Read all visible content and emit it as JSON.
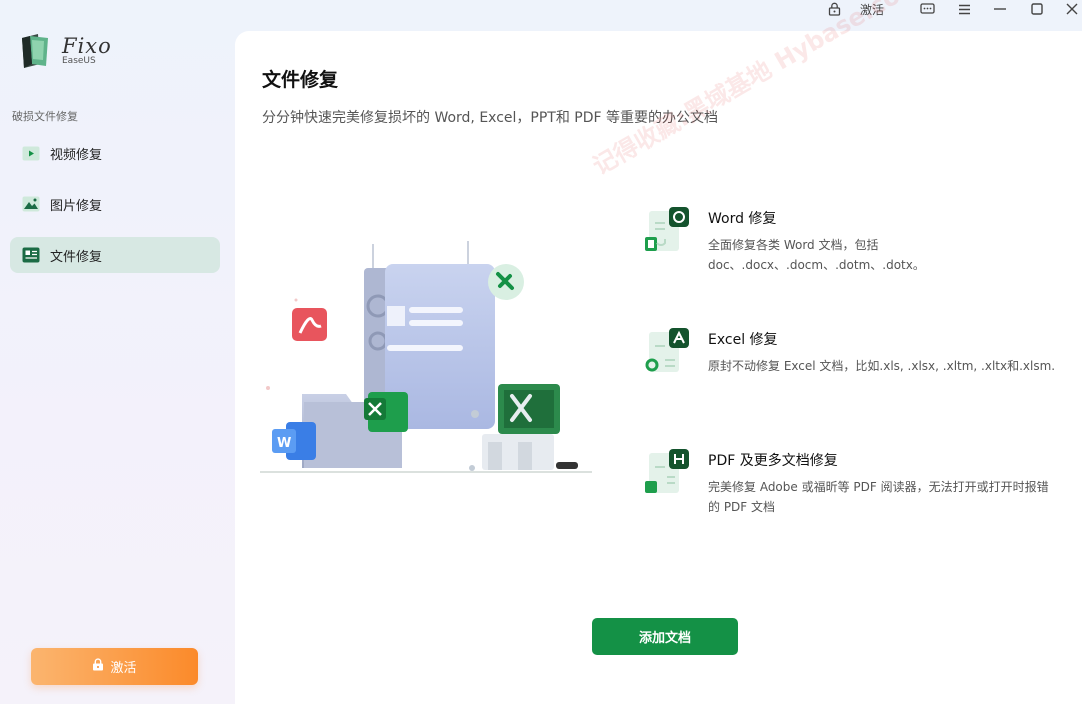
{
  "window": {
    "activate_label": "激活"
  },
  "app": {
    "name": "Fixo",
    "vendor": "EaseUS"
  },
  "sidebar": {
    "section_label": "破损文件修复",
    "items": [
      {
        "label": "视频修复",
        "icon": "video-icon",
        "active": false
      },
      {
        "label": "图片修复",
        "icon": "image-icon",
        "active": false
      },
      {
        "label": "文件修复",
        "icon": "document-icon",
        "active": true
      }
    ],
    "activate_button": "激活"
  },
  "main": {
    "title": "文件修复",
    "subtitle": "分分钟快速完美修复损坏的 Word, Excel，PPT和 PDF 等重要的办公文档",
    "features": [
      {
        "title": "Word 修复",
        "desc": "全面修复各类 Word 文档，包括 doc、.docx、.docm、.dotm、.dotx。",
        "icon": "word-repair-icon"
      },
      {
        "title": "Excel 修复",
        "desc": "原封不动修复 Excel 文档，比如.xls, .xlsx, .xltm, .xltx和.xlsm.",
        "icon": "excel-repair-icon"
      },
      {
        "title": "PDF 及更多文档修复",
        "desc": "完美修复 Adobe 或福昕等 PDF 阅读器，无法打开或打开时报错的 PDF 文档",
        "icon": "pdf-repair-icon"
      }
    ],
    "add_button": "添加文档",
    "watermark": "记得收藏:黑域基地 Hybase.com"
  },
  "colors": {
    "accent": "#149146",
    "active_nav": "#d7e8e3",
    "activate_start": "#fbb56f",
    "activate_end": "#fb8a2a"
  }
}
